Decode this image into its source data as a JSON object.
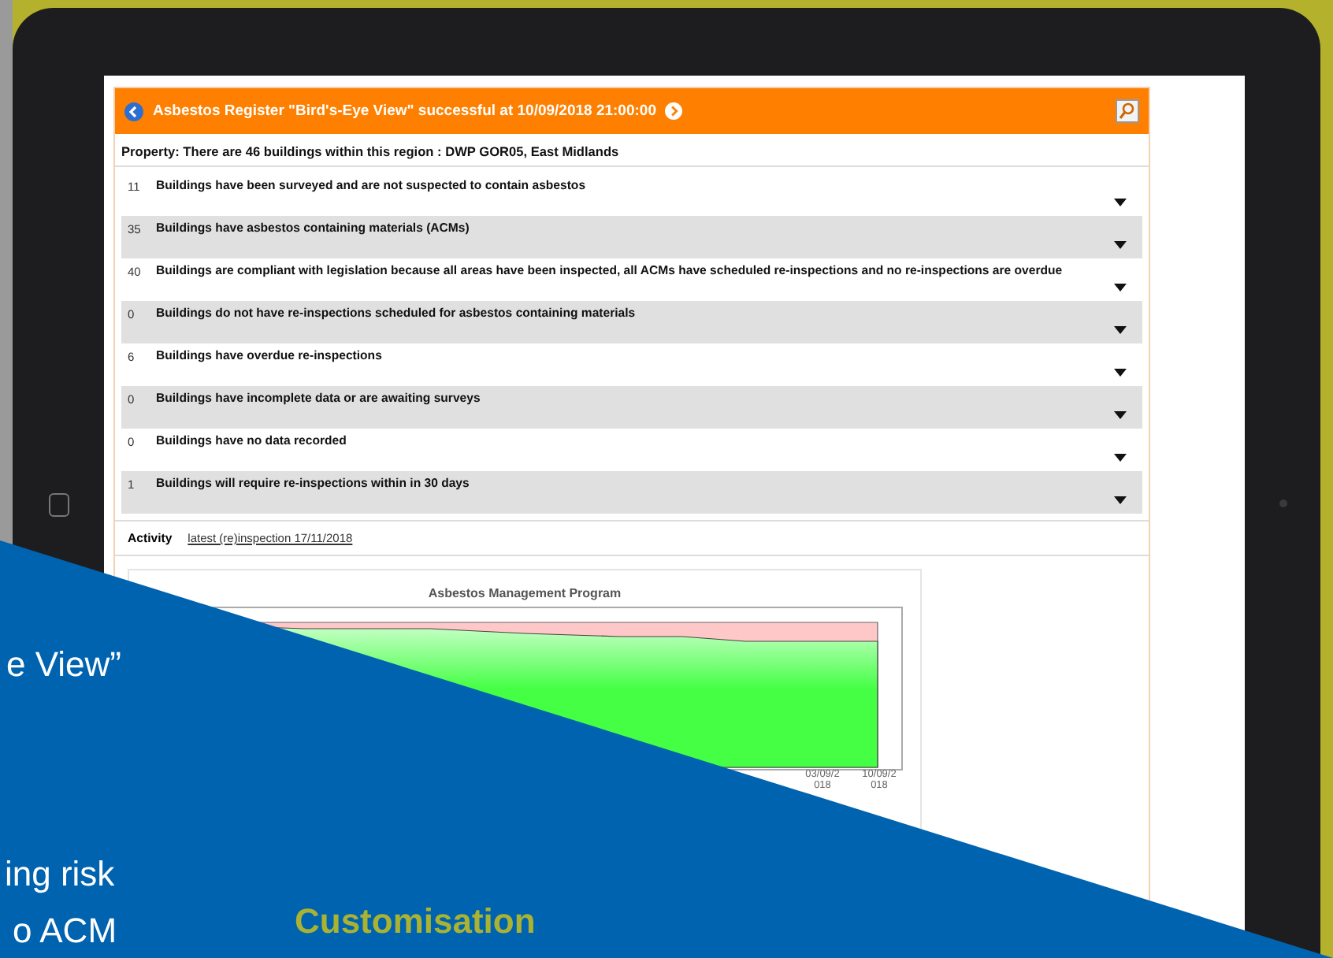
{
  "header": {
    "title": "Asbestos Register \"Bird's-Eye View\" successful at 10/09/2018 21:00:00"
  },
  "property": "Property: There are 46 buildings within this region : DWP GOR05, East Midlands",
  "rows": [
    {
      "count": "11",
      "text": "Buildings have been surveyed and are not suspected to contain asbestos"
    },
    {
      "count": "35",
      "text": "Buildings have asbestos containing materials (ACMs)"
    },
    {
      "count": "40",
      "text": "Buildings are compliant with legislation because all areas have been inspected, all ACMs have scheduled re-inspections and no re-inspections are overdue"
    },
    {
      "count": "0",
      "text": "Buildings do not have re-inspections scheduled for asbestos containing materials"
    },
    {
      "count": "6",
      "text": "Buildings have overdue re-inspections"
    },
    {
      "count": "0",
      "text": "Buildings have incomplete data or are awaiting surveys"
    },
    {
      "count": "0",
      "text": "Buildings have no data recorded"
    },
    {
      "count": "1",
      "text": "Buildings will require re-inspections within in 30 days"
    }
  ],
  "activity": {
    "label": "Activity",
    "link": "latest (re)inspection 17/11/2018"
  },
  "chart": {
    "title": "Asbestos Management Program",
    "x_labels": [
      "03/09/2 018",
      "10/09/2 018"
    ]
  },
  "overlay": {
    "lines": [
      "e View”",
      "ing  risk",
      "o  ACM"
    ],
    "heading": "Customisation"
  }
}
